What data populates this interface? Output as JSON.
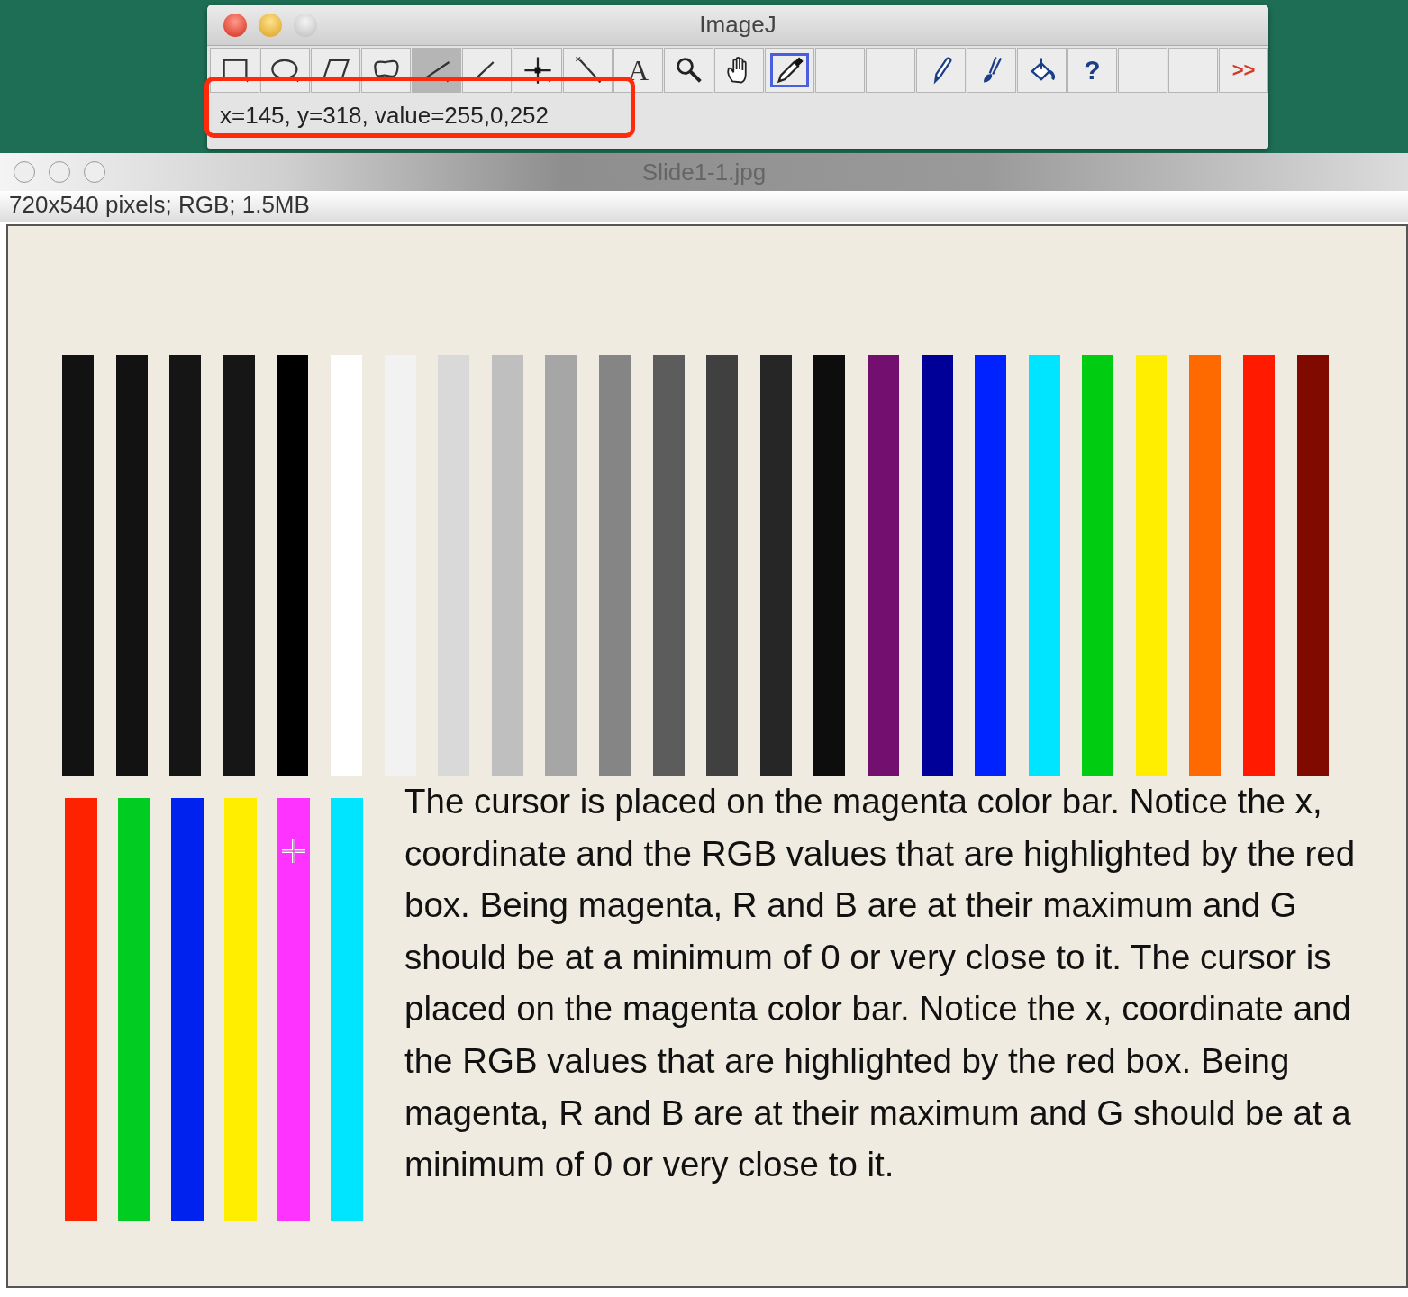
{
  "imagej_window": {
    "title": "ImageJ",
    "tools": [
      {
        "kind": "rectangle",
        "selected": false
      },
      {
        "kind": "oval",
        "selected": false
      },
      {
        "kind": "polygon",
        "selected": false
      },
      {
        "kind": "freehand",
        "selected": false
      },
      {
        "kind": "line",
        "selected": true
      },
      {
        "kind": "angle",
        "selected": false
      },
      {
        "kind": "point",
        "selected": false
      },
      {
        "kind": "wand",
        "selected": false
      },
      {
        "kind": "text",
        "label": "A",
        "selected": false
      },
      {
        "kind": "zoom",
        "selected": false
      },
      {
        "kind": "hand",
        "selected": false
      },
      {
        "kind": "dropper",
        "selected": true
      },
      {
        "kind": "empty",
        "selected": false
      },
      {
        "kind": "empty",
        "selected": false
      },
      {
        "kind": "pencil",
        "selected": false
      },
      {
        "kind": "brush",
        "selected": false
      },
      {
        "kind": "bucket",
        "selected": false
      },
      {
        "kind": "help",
        "label": "?",
        "selected": false
      },
      {
        "kind": "empty",
        "selected": false
      },
      {
        "kind": "empty",
        "selected": false
      },
      {
        "kind": "more",
        "label": ">>",
        "selected": false
      }
    ],
    "status": {
      "text": "x=145, y=318, value=255,0,252",
      "highlighted": true
    }
  },
  "image_window": {
    "title": "Slide1-1.jpg",
    "info": "720x540 pixels; RGB; 1.5MB",
    "slide": {
      "top_bars": [
        {
          "color": "#121212"
        },
        {
          "color": "#121212"
        },
        {
          "color": "#151515"
        },
        {
          "color": "#161616"
        },
        {
          "color": "#000000"
        },
        {
          "color": "#ffffff"
        },
        {
          "color": "#f2f2f2"
        },
        {
          "color": "#d9d9d9"
        },
        {
          "color": "#bfbfbf"
        },
        {
          "color": "#a6a6a6"
        },
        {
          "color": "#858585"
        },
        {
          "color": "#5c5c5c"
        },
        {
          "color": "#404040"
        },
        {
          "color": "#262626"
        },
        {
          "color": "#0d0d0d"
        },
        {
          "color": "#730f6e"
        },
        {
          "color": "#000099"
        },
        {
          "color": "#0022ff"
        },
        {
          "color": "#00e5ff"
        },
        {
          "color": "#00cc11"
        },
        {
          "color": "#ffee00"
        },
        {
          "color": "#ff6a00"
        },
        {
          "color": "#ff1a00"
        },
        {
          "color": "#800a00"
        }
      ],
      "bottom_bars": [
        {
          "color": "#ff2200",
          "cursor": false
        },
        {
          "color": "#00cc22",
          "cursor": false
        },
        {
          "color": "#0022ee",
          "cursor": false
        },
        {
          "color": "#ffee00",
          "cursor": false
        },
        {
          "color": "#ff33ff",
          "cursor": true
        },
        {
          "color": "#00e5ff",
          "cursor": false
        }
      ],
      "text": "The cursor is placed on the magenta color bar. Notice the x, coordinate and the RGB values that are highlighted by the red box. Being magenta, R and B are at their maximum and G should be at a minimum of 0 or very close to it. The cursor is placed on the magenta color bar. Notice the x, coordinate and the RGB values that are highlighted by the red box. Being magenta, R and B are at their maximum and G should be at a minimum of 0 or very close to it."
    }
  }
}
